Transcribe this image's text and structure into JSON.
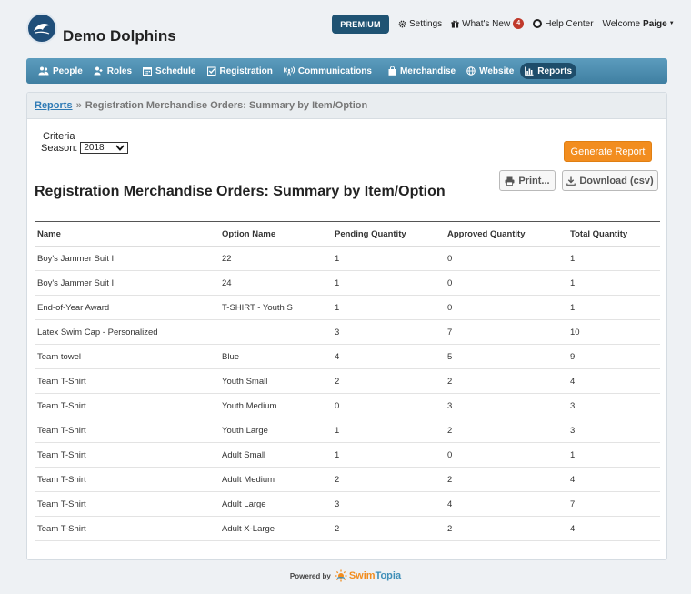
{
  "team": {
    "logo_text": "DOLPHINS SWIM TEAM",
    "name": "Demo Dolphins"
  },
  "header": {
    "premium_label": "PREMIUM",
    "settings_label": "Settings",
    "whats_new_label": "What's New",
    "whats_new_count": "4",
    "help_label": "Help Center",
    "welcome_label": "Welcome",
    "user_name": "Paige"
  },
  "nav": {
    "items": [
      {
        "label": "People",
        "icon": "people-icon"
      },
      {
        "label": "Roles",
        "icon": "roles-icon"
      },
      {
        "label": "Schedule",
        "icon": "calendar-icon"
      },
      {
        "label": "Registration",
        "icon": "checkbox-icon"
      },
      {
        "label": "Communications",
        "icon": "broadcast-icon"
      },
      {
        "label": "Merchandise",
        "icon": "bag-icon"
      },
      {
        "label": "Website",
        "icon": "globe-icon"
      },
      {
        "label": "Reports",
        "icon": "chart-icon",
        "active": true
      }
    ],
    "accent": "#4a8db0",
    "active_color": "#1e4d6b"
  },
  "breadcrumb": {
    "link": "Reports",
    "separator": "»",
    "current": "Registration Merchandise Orders: Summary by Item/Option"
  },
  "criteria": {
    "label": "Criteria",
    "season_label": "Season:",
    "season_value": "2018"
  },
  "buttons": {
    "generate": "Generate Report",
    "print": "Print...",
    "download": "Download (csv)",
    "generate_color": "#f28d1f"
  },
  "report": {
    "title": "Registration Merchandise Orders: Summary by Item/Option",
    "columns": [
      "Name",
      "Option Name",
      "Pending Quantity",
      "Approved Quantity",
      "Total Quantity"
    ],
    "rows": [
      [
        "Boy's Jammer Suit II",
        "22",
        "1",
        "0",
        "1"
      ],
      [
        "Boy's Jammer Suit II",
        "24",
        "1",
        "0",
        "1"
      ],
      [
        "End-of-Year Award",
        "T-SHIRT - Youth S",
        "1",
        "0",
        "1"
      ],
      [
        "Latex Swim Cap - Personalized",
        "",
        "3",
        "7",
        "10"
      ],
      [
        "Team towel",
        "Blue",
        "4",
        "5",
        "9"
      ],
      [
        "Team T-Shirt",
        "Youth Small",
        "2",
        "2",
        "4"
      ],
      [
        "Team T-Shirt",
        "Youth Medium",
        "0",
        "3",
        "3"
      ],
      [
        "Team T-Shirt",
        "Youth Large",
        "1",
        "2",
        "3"
      ],
      [
        "Team T-Shirt",
        "Adult Small",
        "1",
        "0",
        "1"
      ],
      [
        "Team T-Shirt",
        "Adult Medium",
        "2",
        "2",
        "4"
      ],
      [
        "Team T-Shirt",
        "Adult Large",
        "3",
        "4",
        "7"
      ],
      [
        "Team T-Shirt",
        "Adult X-Large",
        "2",
        "2",
        "4"
      ]
    ]
  },
  "footer": {
    "powered_by": "Powered by",
    "brand_swim": "Swim",
    "brand_topia": "Topia"
  }
}
